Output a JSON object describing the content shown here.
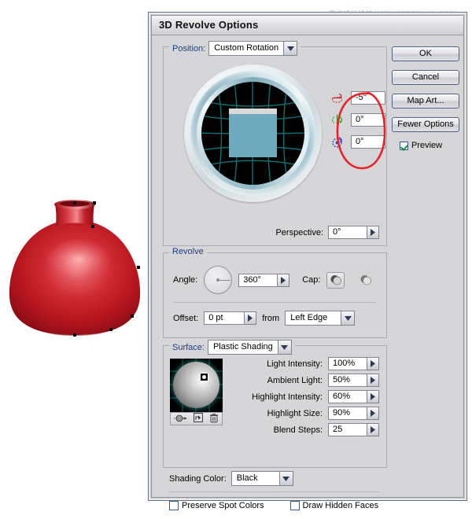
{
  "watermark": {
    "text": "思缘设计论坛 WWW.MISSYUAN.COM"
  },
  "artwork": {
    "name": "red-revolved-vase",
    "fill_color": "#c0202a",
    "highlight_color": "#f08b8f"
  },
  "dialog": {
    "title": "3D Revolve Options",
    "position_group": {
      "legend": "Position:",
      "preset": "Custom Rotation",
      "axes": [
        {
          "icon": "rotate-x-icon",
          "value": "-5°",
          "color": "#cc2222"
        },
        {
          "icon": "rotate-y-icon",
          "value": "0°",
          "color": "#229922"
        },
        {
          "icon": "rotate-z-icon",
          "value": "0°",
          "color": "#2233cc"
        }
      ],
      "perspective_label": "Perspective:",
      "perspective_value": "0°"
    },
    "buttons": {
      "ok": "OK",
      "cancel": "Cancel",
      "map_art": "Map Art...",
      "fewer_options": "Fewer Options",
      "preview_label": "Preview",
      "preview_checked": true
    },
    "revolve_group": {
      "legend": "Revolve",
      "angle_label": "Angle:",
      "angle_value": "360°",
      "cap_label": "Cap:",
      "offset_label": "Offset:",
      "offset_value": "0 pt",
      "from_label": "from",
      "from_value": "Left Edge"
    },
    "surface_group": {
      "legend": "Surface:",
      "shading_type": "Plastic Shading",
      "rows": [
        {
          "label": "Light Intensity:",
          "value": "100%"
        },
        {
          "label": "Ambient Light:",
          "value": "50%"
        },
        {
          "label": "Highlight Intensity:",
          "value": "60%"
        },
        {
          "label": "Highlight Size:",
          "value": "90%"
        },
        {
          "label": "Blend Steps:",
          "value": "25"
        }
      ],
      "light_tools": [
        "new-light-icon",
        "duplicate-light-icon",
        "delete-light-icon"
      ],
      "shading_color_label": "Shading Color:",
      "shading_color_value": "Black",
      "preserve_spot_colors": "Preserve Spot Colors",
      "preserve_spot_colors_checked": false,
      "draw_hidden_faces": "Draw Hidden Faces",
      "draw_hidden_faces_checked": false
    },
    "annotation": {
      "shape": "red-ellipse-highlight",
      "color": "#e8232a"
    }
  }
}
